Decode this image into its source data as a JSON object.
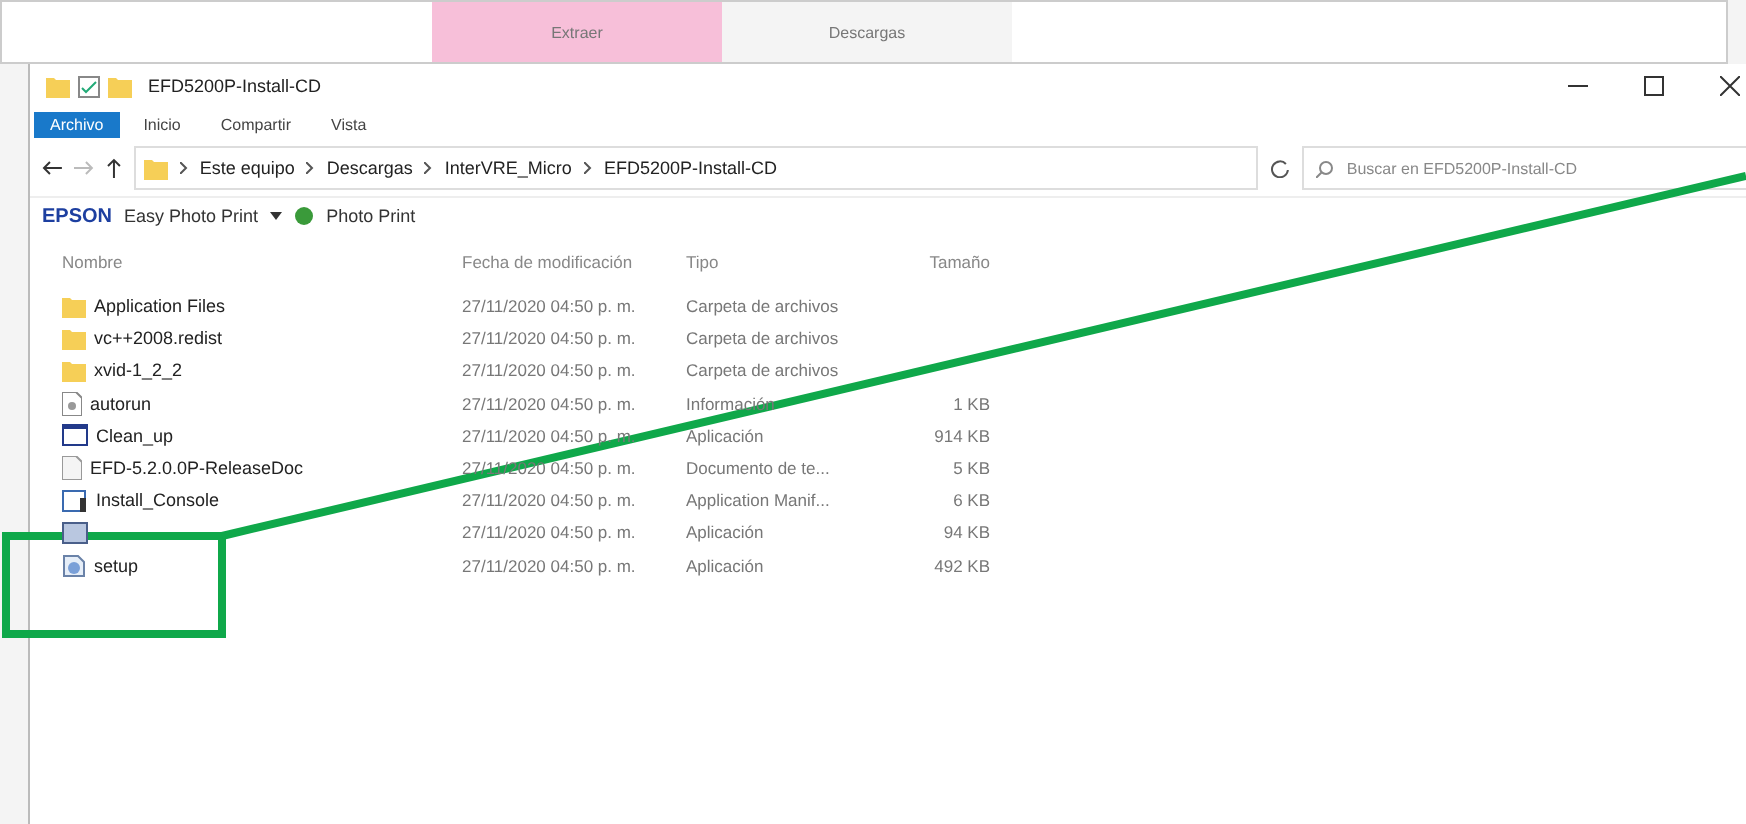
{
  "back_window": {
    "tabs": [
      {
        "label": "Extraer",
        "selected": true
      },
      {
        "label": "Descargas",
        "selected": false
      }
    ]
  },
  "window": {
    "title": "EFD5200P-Install-CD"
  },
  "ribbon_tabs": [
    {
      "label": "Archivo",
      "selected": true
    },
    {
      "label": "Inicio",
      "selected": false
    },
    {
      "label": "Compartir",
      "selected": false
    },
    {
      "label": "Vista",
      "selected": false
    }
  ],
  "breadcrumb": [
    "Este equipo",
    "Descargas",
    "InterVRE_Micro",
    "EFD5200P-Install-CD"
  ],
  "search": {
    "placeholder": "Buscar en EFD5200P-Install-CD"
  },
  "epson_bar": {
    "brand": "EPSON",
    "items": [
      "Easy Photo Print",
      "Photo Print"
    ]
  },
  "columns": [
    "Nombre",
    "Fecha de modificación",
    "Tipo",
    "Tamaño"
  ],
  "rows": [
    {
      "kind": "folder",
      "name": "Application Files",
      "date": "27/11/2020 04:50 p. m.",
      "type": "Carpeta de archivos"
    },
    {
      "kind": "folder",
      "name": "vc++2008.redist",
      "date": "27/11/2020 04:50 p. m.",
      "type": "Carpeta de archivos"
    },
    {
      "kind": "folder",
      "name": "xvid-1_2_2",
      "date": "27/11/2020 04:50 p. m.",
      "type": "Carpeta de archivos"
    },
    {
      "kind": "ini",
      "name": "autorun",
      "date": "27/11/2020 04:50 p. m.",
      "type": "Información",
      "size": "1 KB"
    },
    {
      "kind": "app",
      "name": "Clean_up",
      "date": "27/11/2020 04:50 p. m.",
      "type": "Aplicación",
      "size": "914 KB"
    },
    {
      "kind": "doc",
      "name": "EFD-5.2.0.0P-ReleaseDoc",
      "date": "27/11/2020 04:50 p. m.",
      "type": "Documento de te...",
      "size": "5 KB"
    },
    {
      "kind": "manifest",
      "name": "Install_Console",
      "date": "27/11/2020 04:50 p. m.",
      "type": "Application Manif...",
      "size": "6 KB"
    },
    {
      "kind": "app2",
      "date": "27/11/2020 04:50 p. m.",
      "type": "Aplicación",
      "size": "94 KB"
    },
    {
      "kind": "setup",
      "name": "setup",
      "date": "27/11/2020 04:50 p. m.",
      "type": "Aplicación",
      "size": "492 KB"
    }
  ]
}
